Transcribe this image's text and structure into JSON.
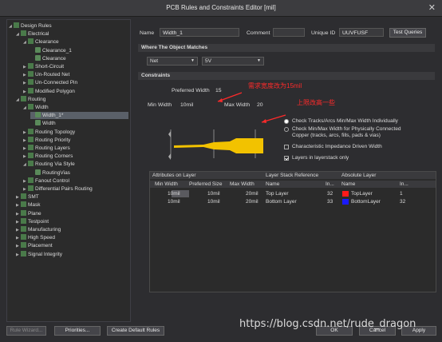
{
  "window": {
    "title": "PCB Rules and Constraints Editor [mil]",
    "close": "✕"
  },
  "tree": [
    {
      "label": "Design Rules",
      "indent": 0,
      "arrow": "◢"
    },
    {
      "label": "Electrical",
      "indent": 1,
      "arrow": "◢"
    },
    {
      "label": "Clearance",
      "indent": 2,
      "arrow": "◢"
    },
    {
      "label": "Clearance_1",
      "indent": 3,
      "arrow": ""
    },
    {
      "label": "Clearance",
      "indent": 3,
      "arrow": ""
    },
    {
      "label": "Short-Circuit",
      "indent": 2,
      "arrow": "▶"
    },
    {
      "label": "Un-Routed Net",
      "indent": 2,
      "arrow": "▶"
    },
    {
      "label": "Un-Connected Pin",
      "indent": 2,
      "arrow": "▶"
    },
    {
      "label": "Modified Polygon",
      "indent": 2,
      "arrow": "▶"
    },
    {
      "label": "Routing",
      "indent": 1,
      "arrow": "◢"
    },
    {
      "label": "Width",
      "indent": 2,
      "arrow": "◢"
    },
    {
      "label": "Width_1*",
      "indent": 3,
      "arrow": "",
      "selected": true
    },
    {
      "label": "Width",
      "indent": 3,
      "arrow": ""
    },
    {
      "label": "Routing Topology",
      "indent": 2,
      "arrow": "▶"
    },
    {
      "label": "Routing Priority",
      "indent": 2,
      "arrow": "▶"
    },
    {
      "label": "Routing Layers",
      "indent": 2,
      "arrow": "▶"
    },
    {
      "label": "Routing Corners",
      "indent": 2,
      "arrow": "▶"
    },
    {
      "label": "Routing Via Style",
      "indent": 2,
      "arrow": "◢"
    },
    {
      "label": "RoutingVias",
      "indent": 3,
      "arrow": ""
    },
    {
      "label": "Fanout Control",
      "indent": 2,
      "arrow": "▶"
    },
    {
      "label": "Differential Pairs Routing",
      "indent": 2,
      "arrow": "▶"
    },
    {
      "label": "SMT",
      "indent": 1,
      "arrow": "▶"
    },
    {
      "label": "Mask",
      "indent": 1,
      "arrow": "▶"
    },
    {
      "label": "Plane",
      "indent": 1,
      "arrow": "▶"
    },
    {
      "label": "Testpoint",
      "indent": 1,
      "arrow": "▶"
    },
    {
      "label": "Manufacturing",
      "indent": 1,
      "arrow": "▶"
    },
    {
      "label": "High Speed",
      "indent": 1,
      "arrow": "▶"
    },
    {
      "label": "Placement",
      "indent": 1,
      "arrow": "▶"
    },
    {
      "label": "Signal Integrity",
      "indent": 1,
      "arrow": "▶"
    }
  ],
  "header": {
    "name_label": "Name",
    "name_value": "Width_1",
    "comment_label": "Comment",
    "comment_value": "",
    "uid_label": "Unique ID",
    "uid_value": "UUVFUSF",
    "test_queries": "Test Queries"
  },
  "where": {
    "title": "Where The Object Matches",
    "scope": "Net",
    "net": "5V"
  },
  "constraints": {
    "title": "Constraints",
    "preferred_label": "Preferred Width",
    "preferred_value": "15",
    "min_label": "Min Width",
    "min_value": "10mil",
    "max_label": "Max Width",
    "max_value": "20",
    "anno_preferred": "需求宽度改为15mil",
    "anno_max": "上限改高一些",
    "options": [
      {
        "label": "Check Tracks/Arcs Min/Max Width Individually",
        "kind": "radio",
        "on": true
      },
      {
        "label": "Check Min/Max Width for Physically Connected",
        "kind": "radio",
        "on": false
      },
      {
        "label": "Copper (tracks, arcs, fills, pads & vias)",
        "kind": "text",
        "on": false
      },
      {
        "label": "Characteristic Impedance Driven Width",
        "kind": "check",
        "on": false
      },
      {
        "label": "Layers in layerstack only",
        "kind": "check",
        "on": true
      }
    ]
  },
  "table": {
    "group_headers": [
      "Attributes on Layer",
      "Layer Stack Reference",
      "Absolute Layer"
    ],
    "columns": [
      "Min Width",
      "Preferred Size",
      "Max Width",
      "Name",
      "In...",
      "Name",
      "In..."
    ],
    "rows": [
      {
        "min": "10mil",
        "pref": "10mil",
        "max": "20mil",
        "name": "Top Layer",
        "idx": "32",
        "abs_name": "TopLayer",
        "abs_idx": "1",
        "color": "#ff1a1a"
      },
      {
        "min": "10mil",
        "pref": "10mil",
        "max": "20mil",
        "name": "Bottom Layer",
        "idx": "33",
        "abs_name": "BottomLayer",
        "abs_idx": "32",
        "color": "#1a1aff"
      }
    ]
  },
  "footer": {
    "rule_wizard": "Rule Wizard...",
    "priorities": "Priorities...",
    "create_default": "Create Default Rules",
    "ok": "OK",
    "cancel": "Cancel",
    "apply": "Apply"
  },
  "watermark": "https://blog.csdn.net/rude_dragon",
  "colors": {
    "accent": "#ff2a2a",
    "track": "#f2c200"
  }
}
